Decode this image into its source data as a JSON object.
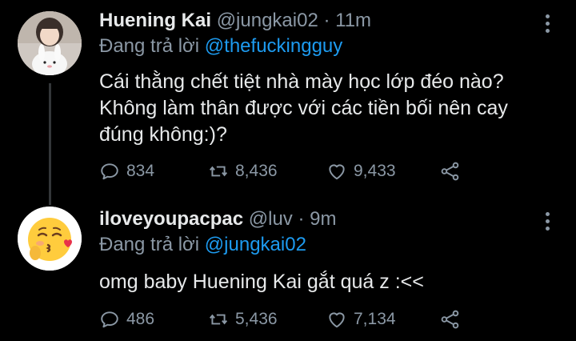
{
  "tweets": [
    {
      "name": "Huening Kai",
      "handle": "@jungkai02",
      "time": "· 11m",
      "reply_prefix": "Đang trả lời",
      "reply_to": "@thefuckingguy",
      "text_lines": [
        "Cái thằng chết tiệt nhà mày học lớp đéo nào?",
        "Không làm thân được với các tiền bối nên cay",
        "đúng không:)?"
      ],
      "replies": "834",
      "retweets": "8,436",
      "likes": "9,433"
    },
    {
      "name": "iloveyoupacpac",
      "handle": "@luv",
      "time": "· 9m",
      "reply_prefix": "Đang trả lời",
      "reply_to": "@jungkai02",
      "text_lines": [
        "omg baby Huening Kai gắt quá z :<<"
      ],
      "replies": "486",
      "retweets": "5,436",
      "likes": "7,134"
    }
  ],
  "icons": {
    "reply": "reply-icon",
    "retweet": "retweet-icon",
    "like": "heart-icon",
    "share": "share-icon",
    "more": "more-options-icon",
    "emoji": "kissing-face-emoji"
  },
  "colors": {
    "background": "#000000",
    "link": "#1d9bf0",
    "muted": "#8b98a5",
    "text": "#e7e9ea"
  }
}
